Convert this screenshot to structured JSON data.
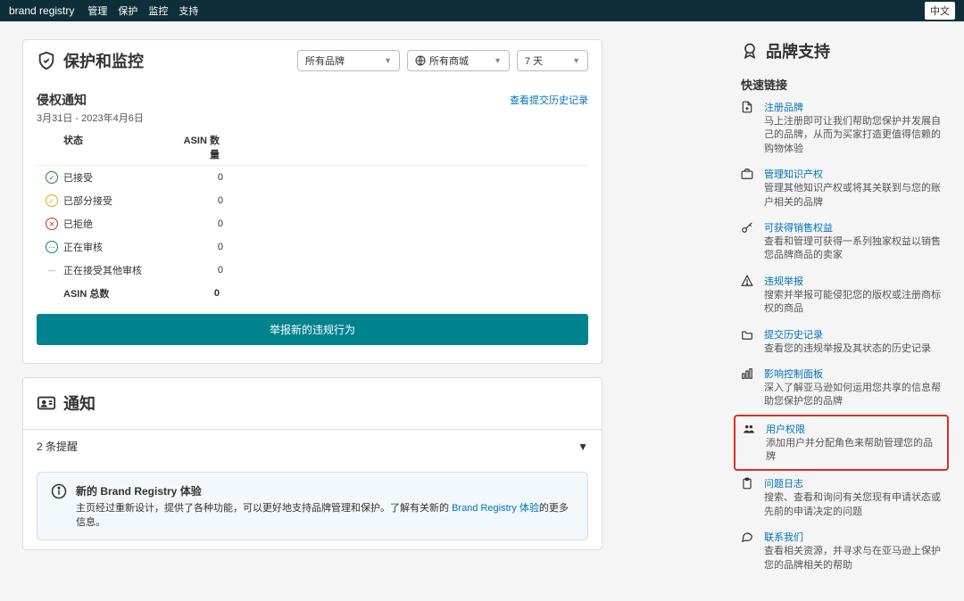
{
  "topbar": {
    "brand": "brand registry",
    "menu": [
      "管理",
      "保护",
      "监控",
      "支持"
    ],
    "lang": "中文"
  },
  "main": {
    "header": "保护和监控",
    "filters": {
      "brand": "所有品牌",
      "market": "所有商城",
      "days": "7 天"
    },
    "violations": {
      "title": "侵权通知",
      "range": "3月31日 - 2023年4月6日",
      "history_link": "查看提交历史记录",
      "cols": {
        "status": "状态",
        "count": "ASIN 数量"
      },
      "rows": [
        {
          "label": "已接受",
          "count": 0,
          "color": "#2e7d32",
          "glyph": "✓"
        },
        {
          "label": "已部分接受",
          "count": 0,
          "color": "#e6a817",
          "glyph": "✓"
        },
        {
          "label": "已拒绝",
          "count": 0,
          "color": "#c9302c",
          "glyph": "✕"
        },
        {
          "label": "正在审核",
          "count": 0,
          "color": "#00838f",
          "glyph": "⋯"
        },
        {
          "label": "正在接受其他审核",
          "count": 0,
          "color": "#888",
          "glyph": "—"
        }
      ],
      "total": {
        "label": "ASIN 总数",
        "count": 0
      },
      "button": "举报新的违规行为"
    },
    "notifications": {
      "title": "通知"
    },
    "tips": {
      "title": "2 条提醒"
    },
    "banner": {
      "title": "新的 Brand Registry 体验",
      "desc_prefix": "主页经过重新设计，提供了各种功能，可以更好地支持品牌管理和保护。了解有关新的 ",
      "link": "Brand Registry 体验",
      "desc_suffix": "的更多信息。"
    }
  },
  "side": {
    "header": "品牌支持",
    "quick": "快速链接",
    "items": [
      {
        "title": "注册品牌",
        "desc": "马上注册即可让我们帮助您保护并发展自己的品牌，从而为买家打造更值得信赖的购物体验",
        "icon": "file-plus"
      },
      {
        "title": "管理知识产权",
        "desc": "管理其他知识产权或将其关联到与您的账户相关的品牌",
        "icon": "briefcase"
      },
      {
        "title": "可获得销售权益",
        "desc": "查看和管理可获得一系列独家权益以销售您品牌商品的卖家",
        "icon": "key"
      },
      {
        "title": "违规举报",
        "desc": "搜索并举报可能侵犯您的版权或注册商标权的商品",
        "icon": "warning"
      },
      {
        "title": "提交历史记录",
        "desc": "查看您的违规举报及其状态的历史记录",
        "icon": "folder"
      },
      {
        "title": "影响控制面板",
        "desc": "深入了解亚马逊如何运用您共享的信息帮助您保护您的品牌",
        "icon": "chart"
      },
      {
        "title": "用户权限",
        "desc": "添加用户并分配角色来帮助管理您的品牌",
        "icon": "users",
        "highlight": true
      },
      {
        "title": "问题日志",
        "desc": "搜索、查看和询问有关您现有申请状态或先前的申请决定的问题",
        "icon": "clipboard"
      },
      {
        "title": "联系我们",
        "desc": "查看相关资源，并寻求与在亚马逊上保护您的品牌相关的帮助",
        "icon": "chat"
      }
    ]
  }
}
